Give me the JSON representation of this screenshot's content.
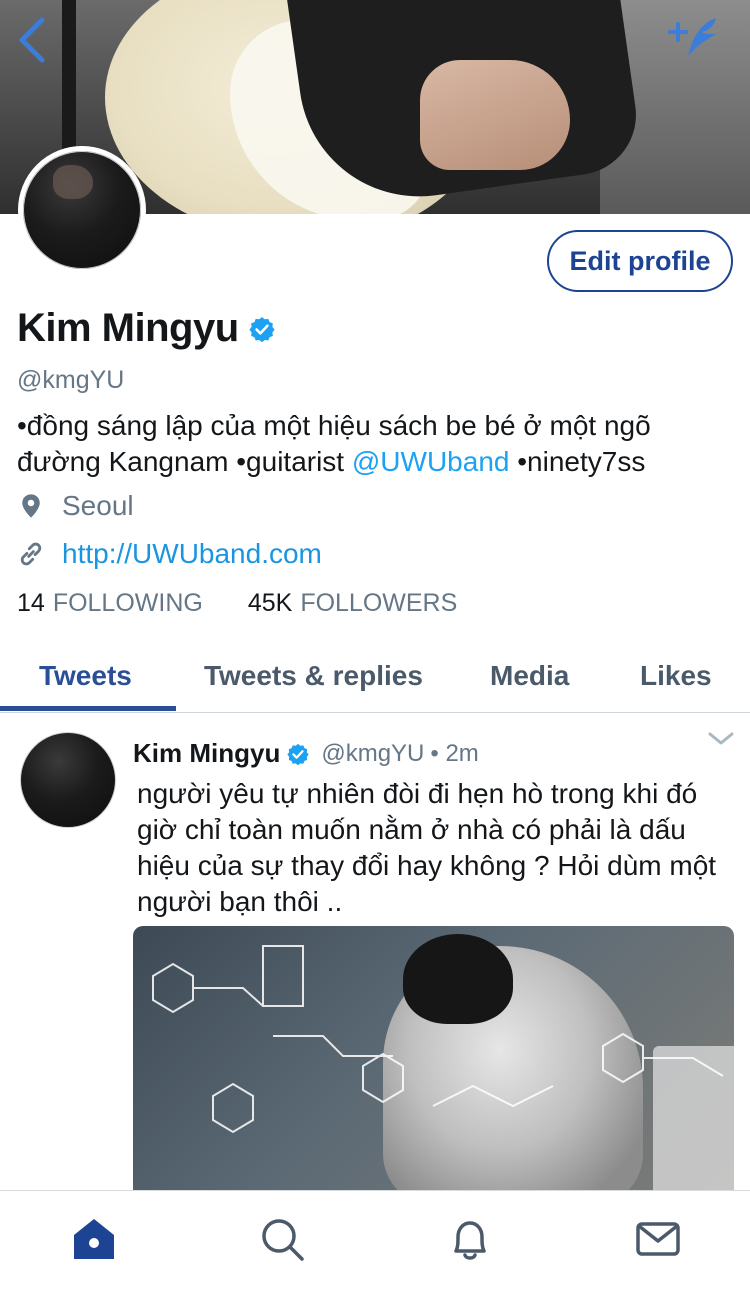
{
  "header": {
    "back_icon": "chevron-left-icon",
    "compose_icon": "compose-tweet-icon"
  },
  "profile": {
    "name": "Kim Mingyu",
    "handle": "@kmgYU",
    "bio_part1": "•đồng sáng lập của một hiệu sách be bé ở một ngõ đường Kangnam •guitarist ",
    "bio_link": "@UWUband",
    "bio_part2": " •ninety7ss",
    "location": "Seoul",
    "url": "http://UWUband.com",
    "following_count": "14",
    "following_label": "FOLLOWING",
    "followers_count": "45K",
    "followers_label": "FOLLOWERS",
    "edit_button": "Edit profile"
  },
  "tabs": [
    {
      "label": "Tweets",
      "active": true
    },
    {
      "label": "Tweets & replies",
      "active": false
    },
    {
      "label": "Media",
      "active": false
    },
    {
      "label": "Likes",
      "active": false
    }
  ],
  "tweet": {
    "author_name": "Kim Mingyu",
    "author_handle": "@kmgYU",
    "time": "• 2m",
    "text": "người yêu tự nhiên đòi đi hẹn hò trong khi đó giờ chỉ toàn muốn nằm ở nhà có phải là dấu hiệu của sự thay đổi hay không ? Hỏi dùm một người bạn thôi .."
  },
  "bottom_nav": [
    "home-icon",
    "search-icon",
    "notifications-icon",
    "messages-icon"
  ],
  "colors": {
    "accent": "#1c4493",
    "link": "#1da1f2",
    "muted": "#657786",
    "verified": "#1da1f2"
  }
}
